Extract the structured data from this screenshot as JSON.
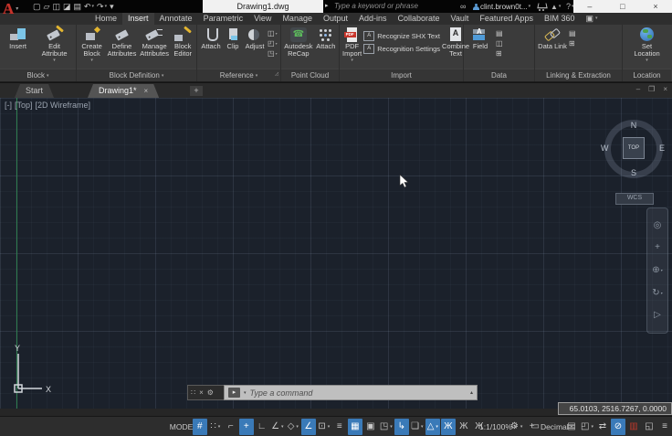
{
  "ui": {
    "caret": "▾",
    "caret_up": "▴",
    "caret_right": "▸",
    "close": "×",
    "grip": "∷",
    "launcher": "◿",
    "binoculars": "∞",
    "help": "?",
    "letter_a": "A",
    "pdf_label": "PDF",
    "phone": "☎",
    "wrench": "⚙"
  },
  "titlebar": {
    "app_button": "A",
    "qat": [
      {
        "name": "qat-new-button",
        "glyph": "▢"
      },
      {
        "name": "qat-open-button",
        "glyph": "▱"
      },
      {
        "name": "qat-save-button",
        "glyph": "◫"
      },
      {
        "name": "qat-saveas-button",
        "glyph": "◪"
      },
      {
        "name": "qat-plot-button",
        "glyph": "▤"
      },
      {
        "name": "qat-undo-button",
        "glyph": "↶",
        "caret": true
      },
      {
        "name": "qat-redo-button",
        "glyph": "↷",
        "caret": true
      },
      {
        "name": "qat-menu-button",
        "glyph": "▾"
      }
    ],
    "document_title": "Drawing1.dwg",
    "search_placeholder": "Type a keyword or phrase",
    "signin_user": "clint.brown0t...",
    "help_label": "?",
    "window_controls": [
      {
        "name": "minimize-button",
        "glyph": "–"
      },
      {
        "name": "maximize-button",
        "glyph": "□"
      },
      {
        "name": "close-button",
        "glyph": "×"
      }
    ]
  },
  "ribbon_tabs": [
    {
      "name": "tab-home",
      "label": "Home"
    },
    {
      "name": "tab-insert",
      "label": "Insert",
      "active": true
    },
    {
      "name": "tab-annotate",
      "label": "Annotate"
    },
    {
      "name": "tab-parametric",
      "label": "Parametric"
    },
    {
      "name": "tab-view",
      "label": "View"
    },
    {
      "name": "tab-manage",
      "label": "Manage"
    },
    {
      "name": "tab-output",
      "label": "Output"
    },
    {
      "name": "tab-addins",
      "label": "Add-ins"
    },
    {
      "name": "tab-collaborate",
      "label": "Collaborate"
    },
    {
      "name": "tab-vault",
      "label": "Vault"
    },
    {
      "name": "tab-featured-apps",
      "label": "Featured Apps"
    },
    {
      "name": "tab-bim-360",
      "label": "BIM 360"
    },
    {
      "name": "ribbon-display-button",
      "label": "▣",
      "caret": true
    }
  ],
  "ribbon": {
    "block": {
      "caption": "Block",
      "insert": "Insert",
      "edit_attribute": "Edit Attribute"
    },
    "block_definition": {
      "caption": "Block Definition",
      "create": "Create Block",
      "define": "Define Attributes",
      "manage": "Manage Attributes",
      "editor": "Block Editor"
    },
    "reference": {
      "caption": "Reference",
      "attach": "Attach",
      "clip": "Clip",
      "adjust": "Adjust",
      "small": [
        {
          "name": "underlay-layers-button",
          "glyph": "◫",
          "caret": true
        },
        {
          "name": "frames-button",
          "glyph": "◰",
          "caret": true
        },
        {
          "name": "snap-to-underlays-button",
          "glyph": "◳",
          "caret": true
        }
      ]
    },
    "point_cloud": {
      "caption": "Point Cloud",
      "recap": "Autodesk ReCap",
      "attach": "Attach"
    },
    "import": {
      "caption": "Import",
      "pdf": "PDF Import",
      "recognize": "Recognize SHX Text",
      "settings": "Recognition Settings",
      "combine": "Combine Text"
    },
    "data": {
      "caption": "Data",
      "field": "Field",
      "small": [
        {
          "name": "update-fields-button",
          "glyph": "▤"
        },
        {
          "name": "ole-object-button",
          "glyph": "◫"
        },
        {
          "name": "hyperlink-button",
          "glyph": "⊞"
        }
      ]
    },
    "linking": {
      "caption": "Linking & Extraction",
      "datalink": "Data Link",
      "small": [
        {
          "name": "extract-data-button",
          "glyph": "▤"
        },
        {
          "name": "upload-to-source-button",
          "glyph": "⊞"
        }
      ]
    },
    "location": {
      "caption": "Location",
      "set_location": "Set Location"
    }
  },
  "file_tabs": {
    "start": "Start",
    "drawing": "Drawing1*",
    "new_tab": "+"
  },
  "viewport": {
    "segments": [
      {
        "name": "viewport-menu-control",
        "label": "[-]"
      },
      {
        "name": "viewport-view-control",
        "label": "[Top]"
      },
      {
        "name": "viewport-visual-style-control",
        "label": "[2D Wireframe]"
      }
    ]
  },
  "viewcube": {
    "north": "N",
    "east": "E",
    "south": "S",
    "west": "W",
    "top": "TOP",
    "wcs": "WCS"
  },
  "ucs": {
    "x_label": "X",
    "y_label": "Y"
  },
  "navbar": [
    {
      "name": "navigation-wheel-button",
      "glyph": "◎"
    },
    {
      "name": "pan-button",
      "glyph": "+"
    },
    {
      "name": "zoom-button",
      "glyph": "⊕",
      "caret": true
    },
    {
      "name": "orbit-button",
      "glyph": "↻",
      "caret": true
    },
    {
      "name": "showmotion-button",
      "glyph": "▷"
    }
  ],
  "command_line": {
    "placeholder": "Type a command"
  },
  "coordinates": "65.0103, 2516.7267, 0.0000",
  "statusbar": {
    "items": [
      {
        "name": "model-space-button",
        "text": "MODEL"
      },
      {
        "name": "grid-display-toggle",
        "glyph": "#",
        "on": true
      },
      {
        "name": "snap-mode-toggle",
        "glyph": "∷",
        "caret": true
      },
      {
        "name": "infer-constraints-toggle",
        "glyph": "⌐"
      },
      {
        "name": "dynamic-input-toggle",
        "glyph": "+",
        "on": true
      },
      {
        "name": "ortho-mode-toggle",
        "glyph": "∟"
      },
      {
        "name": "polar-tracking-toggle",
        "glyph": "∠",
        "caret": true
      },
      {
        "name": "isometric-drafting-toggle",
        "glyph": "◇",
        "caret": true
      },
      {
        "name": "object-snap-tracking-toggle",
        "glyph": "∠",
        "on": true
      },
      {
        "name": "object-snap-toggle",
        "glyph": "⊡",
        "caret": true
      },
      {
        "name": "lineweight-toggle",
        "glyph": "≡"
      },
      {
        "name": "transparency-toggle",
        "glyph": "▦",
        "on": true
      },
      {
        "name": "selection-cycling-toggle",
        "glyph": "▣"
      },
      {
        "name": "3d-object-snap-toggle",
        "glyph": "◳",
        "caret": true
      },
      {
        "name": "dynamic-ucs-toggle",
        "glyph": "↳",
        "on": true
      },
      {
        "name": "selection-filtering-toggle",
        "glyph": "❏",
        "caret": true
      },
      {
        "name": "gizmo-toggle",
        "glyph": "△",
        "on": true,
        "caret": true
      },
      {
        "name": "annotation-visibility-toggle",
        "glyph": "Ж",
        "on": true
      },
      {
        "name": "autoscale-toggle",
        "glyph": "Ж"
      },
      {
        "name": "annotation-scale-visibility-toggle",
        "glyph": "Ж"
      },
      {
        "name": "annotation-scale-button",
        "text": "1:1/100%",
        "caret": true
      },
      {
        "name": "workspace-switching-button",
        "glyph": "⚙",
        "caret": true
      },
      {
        "name": "annotation-monitor-toggle",
        "glyph": "+"
      },
      {
        "name": "units-button",
        "glyph": "▭",
        "text": "Decimal",
        "caret": true
      },
      {
        "name": "quick-properties-toggle",
        "glyph": "▤"
      },
      {
        "name": "lock-ui-button",
        "glyph": "◰",
        "caret": true
      },
      {
        "name": "hardware-acceleration-toggle",
        "glyph": "⇄"
      },
      {
        "name": "isolate-objects-button",
        "glyph": "⊘",
        "on": true
      },
      {
        "name": "graphics-performance-toggle",
        "glyph": "▥",
        "red": true
      },
      {
        "name": "clean-screen-button",
        "glyph": "◱"
      },
      {
        "name": "customization-button",
        "glyph": "≡"
      }
    ]
  }
}
